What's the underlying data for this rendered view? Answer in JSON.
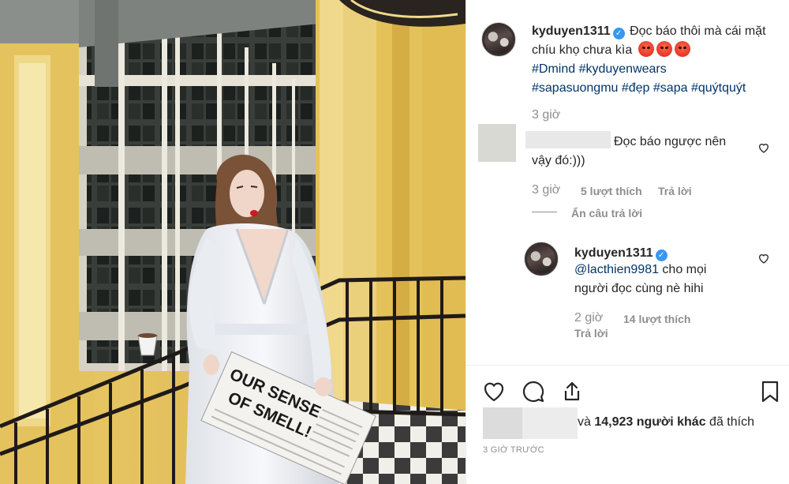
{
  "post": {
    "author": "kyduyen1311",
    "caption_text": "Đọc báo thôi mà cái mặt chíu khọ chưa kìa",
    "hashtags_line1": "#Dmind #kyduyenwears",
    "hashtags_line2": "#sapasuongmu #đẹp #sapa #quýtquýt",
    "caption_time": "3 giờ",
    "photo_newspaper_text": "OUR SENSE OF SMELL!"
  },
  "comments": [
    {
      "text_line1": "Đọc báo ngược nên",
      "text_line2": "vậy đó:)))",
      "time": "3 giờ",
      "likes": "5 lượt thích",
      "reply": "Trả lời",
      "hide_replies": "Ẩn câu trả lời"
    }
  ],
  "reply": {
    "author": "kyduyen1311",
    "mention": "@lacthien9981",
    "text_after_mention": " cho mọi",
    "text_line2": "người đọc cùng nè hihi",
    "time": "2 giờ",
    "likes": "14 lượt thích",
    "reply": "Trả lời"
  },
  "likes": {
    "prefix": "và ",
    "count": "14,923 người khác",
    "suffix": " đã thích"
  },
  "timestamp": "3 GIỜ TRƯỚC",
  "colors": {
    "verified": "#3897f0",
    "link": "#003569",
    "muted": "#8e8e8e"
  },
  "icons": [
    "verified-icon",
    "angry-emoji-icon",
    "heart-icon",
    "comment-icon",
    "share-icon",
    "bookmark-icon"
  ]
}
